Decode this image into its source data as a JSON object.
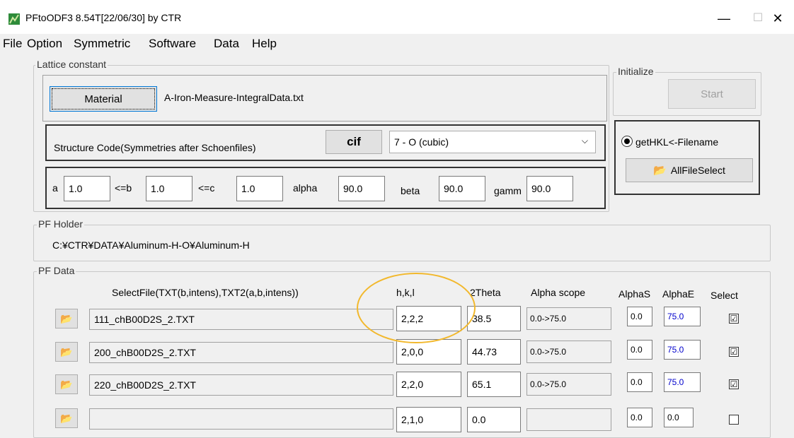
{
  "window": {
    "title": "PFtoODF3 8.54T[22/06/30] by CTR",
    "min": "—",
    "max": "☐",
    "close": "✕"
  },
  "menu": [
    "File",
    "Option",
    "Symmetric",
    "Software",
    "Data",
    "Help"
  ],
  "lattice": {
    "group_label": "Lattice constant",
    "material_button": "Material",
    "material_file": "A-Iron-Measure-IntegralData.txt",
    "structure_label": "Structure Code(Symmetries after Schoenfiles)",
    "cif_button": "cif",
    "structure_value": "7 - O (cubic)",
    "a_label": "a",
    "a": "1.0",
    "b_label": "<=b",
    "b": "1.0",
    "c_label": "<=c",
    "c": "1.0",
    "alpha_label": "alpha",
    "alpha": "90.0",
    "beta_label": "beta",
    "beta": "90.0",
    "gamma_label": "gamm",
    "gamma": "90.0"
  },
  "initialize": {
    "group_label": "Initialize",
    "start_button": "Start"
  },
  "hkl": {
    "radio_label": "getHKL<-Filename",
    "allfile_button": "AllFileSelect"
  },
  "pf_holder": {
    "group_label": "PF Holder",
    "path": "C:¥CTR¥DATA¥Aluminum-H-O¥Aluminum-H"
  },
  "pf_data": {
    "group_label": "PF Data",
    "headers": {
      "selectfile": "SelectFile(TXT(b,intens),TXT2(a,b,intens))",
      "hkl": "h,k,l",
      "theta": "2Theta",
      "alpha_scope": "Alpha scope",
      "alphaS": "AlphaS",
      "alphaE": "AlphaE",
      "select": "Select"
    },
    "rows": [
      {
        "file": "111_chB00D2S_2.TXT",
        "hkl": "2,2,2",
        "theta": "38.5",
        "scope": "0.0->75.0",
        "alphaS": "0.0",
        "alphaE": "75.0",
        "checked": "☑"
      },
      {
        "file": "200_chB00D2S_2.TXT",
        "hkl": "2,0,0",
        "theta": "44.73",
        "scope": "0.0->75.0",
        "alphaS": "0.0",
        "alphaE": "75.0",
        "checked": "☑"
      },
      {
        "file": "220_chB00D2S_2.TXT",
        "hkl": "2,2,0",
        "theta": "65.1",
        "scope": "0.0->75.0",
        "alphaS": "0.0",
        "alphaE": "75.0",
        "checked": "☑"
      },
      {
        "file": "",
        "hkl": "2,1,0",
        "theta": "0.0",
        "scope": "",
        "alphaS": "0.0",
        "alphaE": "0.0",
        "checked": ""
      }
    ]
  },
  "colors": {
    "alphaE_text": "#0000cc",
    "highlight": "#f2b82c"
  }
}
